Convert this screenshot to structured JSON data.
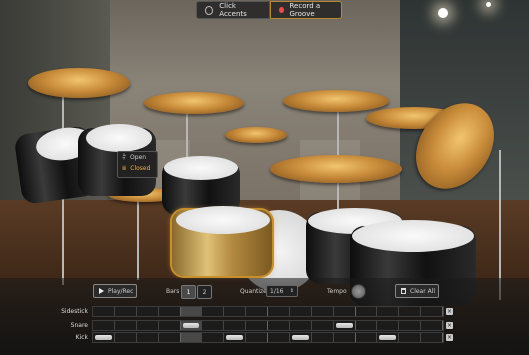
{
  "topbar": {
    "click_accents_label": "Click Accents",
    "record_groove_label": "Record a Groove",
    "record_color": "#e74c4c"
  },
  "hihat_menu": {
    "items": [
      {
        "label": "Open",
        "icon": "hihat-open-icon",
        "selected": false
      },
      {
        "label": "Closed",
        "icon": "hihat-closed-icon",
        "selected": true
      }
    ]
  },
  "editor": {
    "play_rec_label": "Play/Rec",
    "bars_label": "Bars",
    "bars_options": [
      "1",
      "2"
    ],
    "bars_selected": "1",
    "quantize_label": "Quantize",
    "quantize_value": "1/16",
    "tempo_label": "Tempo",
    "clear_all_label": "Clear All",
    "steps": 16,
    "lanes": [
      {
        "name": "Sidestick",
        "notes": []
      },
      {
        "name": "Snare",
        "notes": [
          4,
          11
        ]
      },
      {
        "name": "Kick",
        "notes": [
          0,
          6,
          9,
          13
        ]
      }
    ],
    "selected_step": 4,
    "accent_color": "#c8902c"
  }
}
